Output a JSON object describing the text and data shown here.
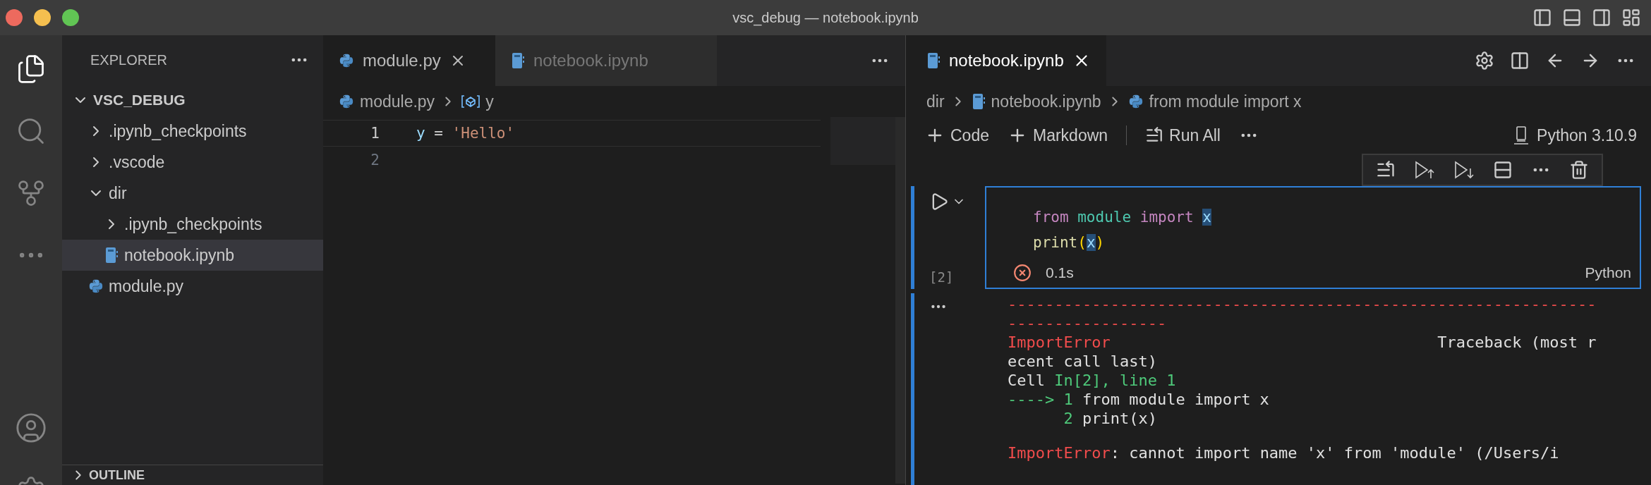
{
  "window": {
    "title": "vsc_debug — notebook.ipynb"
  },
  "sidebar": {
    "title": "EXPLORER",
    "tree": [
      {
        "label": "VSC_DEBUG",
        "kind": "root",
        "expanded": true,
        "selected": false,
        "children": [
          {
            "label": ".ipynb_checkpoints",
            "kind": "folder",
            "expanded": false,
            "selected": false
          },
          {
            "label": ".vscode",
            "kind": "folder",
            "expanded": false,
            "selected": false
          },
          {
            "label": "dir",
            "kind": "folder",
            "expanded": true,
            "selected": false,
            "children": [
              {
                "label": ".ipynb_checkpoints",
                "kind": "folder",
                "expanded": false,
                "selected": false
              },
              {
                "label": "notebook.ipynb",
                "kind": "notebook",
                "selected": true
              }
            ]
          },
          {
            "label": "module.py",
            "kind": "python",
            "selected": false
          }
        ]
      }
    ],
    "outline": {
      "label": "OUTLINE",
      "expanded": false
    }
  },
  "left_editor": {
    "tabs": [
      {
        "label": "module.py",
        "kind": "python",
        "selected": true
      },
      {
        "label": "notebook.ipynb",
        "kind": "notebook",
        "selected": false
      }
    ],
    "breadcrumb": [
      {
        "label": "module.py",
        "kind": "python"
      },
      {
        "label": "y",
        "kind": "symbol"
      }
    ],
    "lines": [
      {
        "number": "1",
        "current": true,
        "tokens": [
          {
            "text": "y",
            "kind": "var"
          },
          {
            "text": " = ",
            "kind": "plain"
          },
          {
            "text": "'Hello'",
            "kind": "string"
          }
        ]
      },
      {
        "number": "2",
        "current": false
      }
    ]
  },
  "notebook": {
    "tabs": [
      {
        "label": "notebook.ipynb",
        "kind": "notebook",
        "selected": true
      }
    ],
    "breadcrumb": [
      {
        "label": "dir",
        "kind": "folder"
      },
      {
        "label": "notebook.ipynb",
        "kind": "notebook"
      },
      {
        "label": "from module import x",
        "kind": "python"
      }
    ],
    "toolbar": [
      {
        "label": "Code",
        "kind": "add"
      },
      {
        "label": "Markdown",
        "kind": "add"
      },
      {
        "label": "Run All",
        "kind": "run"
      }
    ],
    "kernel": "Python 3.10.9",
    "cell": {
      "count": "[2]",
      "failed": true,
      "time": "0.1s",
      "language": "Python",
      "lines": [
        {
          "tokens": [
            {
              "text": "from ",
              "kind": "keyword"
            },
            {
              "text": "module ",
              "kind": "module"
            },
            {
              "text": "import ",
              "kind": "keyword"
            },
            {
              "text": "x",
              "kind": "var",
              "highlighted": true
            }
          ]
        },
        {
          "tokens": [
            {
              "text": "print",
              "kind": "func"
            },
            {
              "text": "(",
              "kind": "bracket"
            },
            {
              "text": "x",
              "kind": "var",
              "highlighted": true
            },
            {
              "text": ")",
              "kind": "bracket"
            }
          ]
        }
      ]
    },
    "output": {
      "blocks": [
        [
          {
            "segments": [
              {
                "text": "---------------------------------------------------------------",
                "kind": "error"
              }
            ]
          },
          {
            "segments": [
              {
                "text": "-----------------",
                "kind": "error"
              }
            ]
          },
          {
            "segments": [
              {
                "text": "ImportError",
                "kind": "error"
              },
              {
                "text": "                                   Traceback (most r",
                "kind": "plain"
              }
            ]
          },
          {
            "segments": [
              {
                "text": "ecent call last)",
                "kind": "plain"
              }
            ]
          },
          {
            "segments": [
              {
                "text": "Cell ",
                "kind": "plain"
              },
              {
                "text": "In[2], line 1",
                "kind": "green"
              }
            ]
          },
          {
            "segments": [
              {
                "text": "----> 1",
                "kind": "green"
              },
              {
                "text": " from module import x",
                "kind": "plain"
              }
            ]
          },
          {
            "segments": [
              {
                "text": "      2",
                "kind": "green"
              },
              {
                "text": " print(x)",
                "kind": "plain"
              }
            ]
          }
        ],
        [
          {
            "segments": [
              {
                "text": "ImportError",
                "kind": "error"
              },
              {
                "text": ": cannot import name 'x' from 'module' (/Users/i",
                "kind": "plain"
              }
            ]
          }
        ]
      ]
    }
  }
}
